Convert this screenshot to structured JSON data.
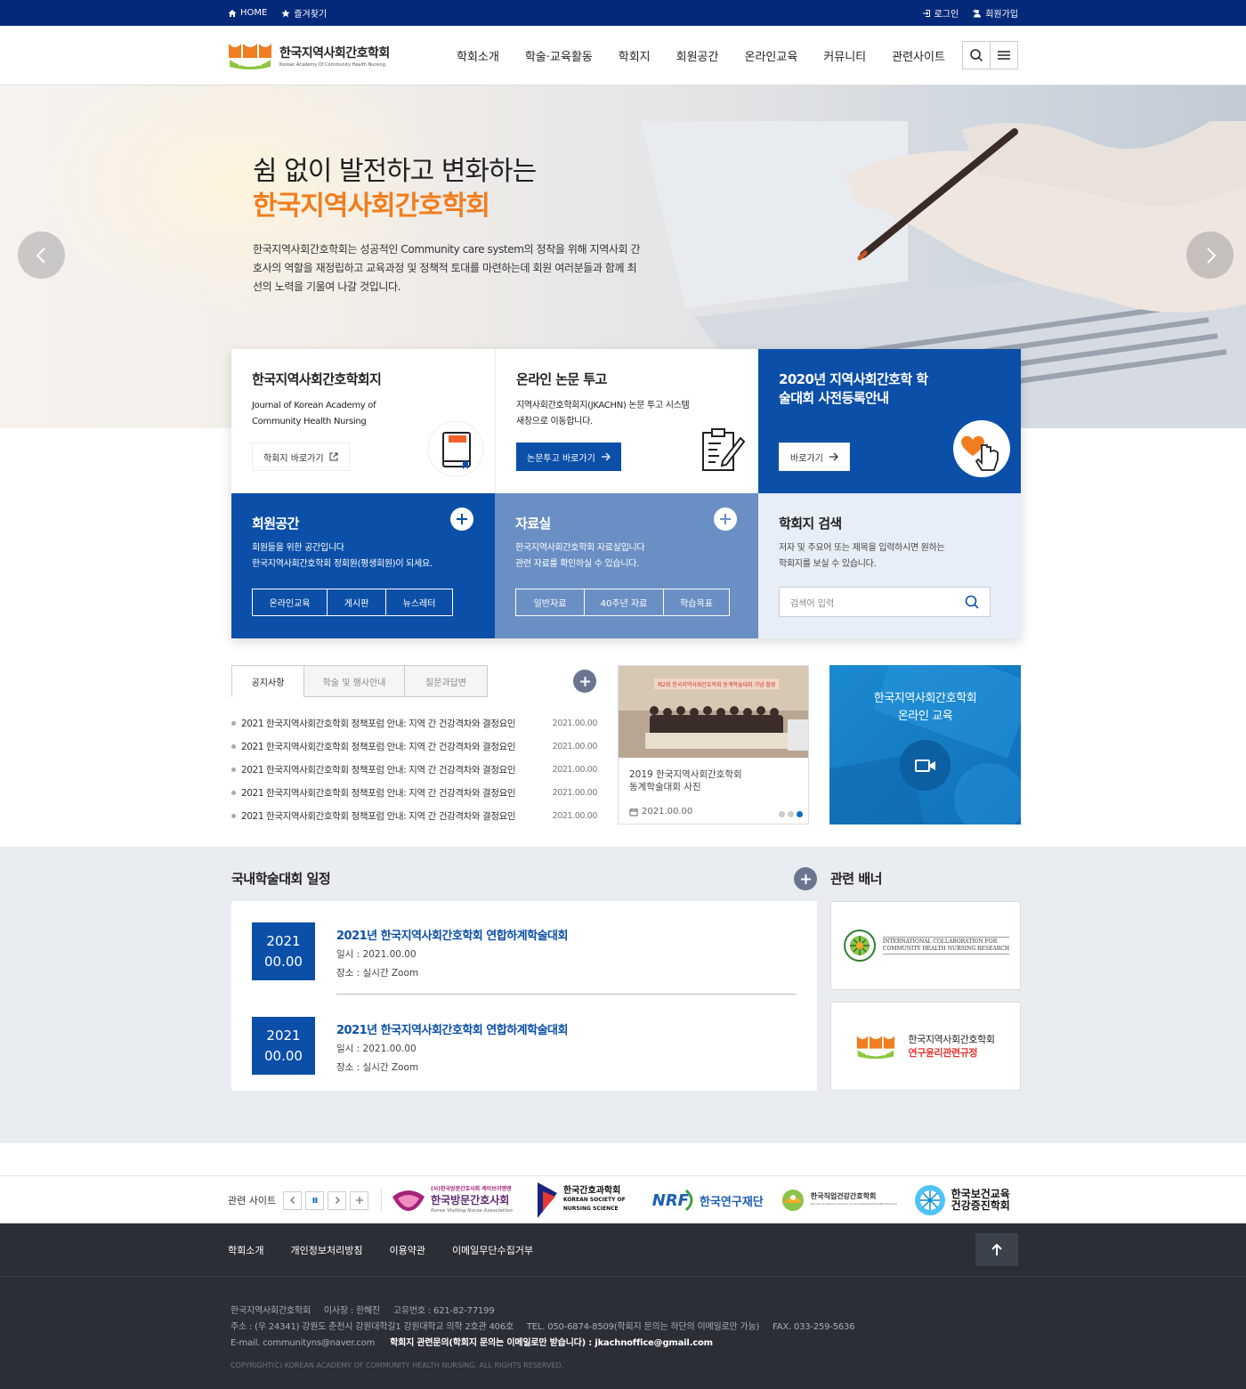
{
  "topbar": {
    "home": "HOME",
    "favorite": "즐겨찾기",
    "login": "로그인",
    "join": "회원가입"
  },
  "header": {
    "logo_ko": "한국지역사회간호학회",
    "logo_en": "Korean Academy Of Community Health Nursing",
    "logo_mark": "KACHN",
    "nav": [
      "학회소개",
      "학술·교육활동",
      "학회지",
      "회원공간",
      "온라인교육",
      "커뮤니티",
      "관련사이트"
    ]
  },
  "hero": {
    "line1": "쉼 없이 발전하고 변화하는",
    "line2": "한국지역사회간호학회",
    "desc": "한국지역사회간호학회는 성공적인 Community care system의 정착을 위해 지역사회 간호사의 역할을 재정립하고 교육과정 및 정책적 토대를 마련하는데 회원 여러분들과 함께 최선의 노력을 기울여 나갈 것입니다."
  },
  "cards": {
    "journal": {
      "title": "한국지역사회간호학회지",
      "desc": "Journal of Korean Academy of Community Health Nursing",
      "button": "학회지 바로가기"
    },
    "submit": {
      "title": "온라인 논문 투고",
      "desc": "지역사회간호학회지(JKACHN) 논문 투고 시스템 새창으로 이동합니다.",
      "button": "논문투고 바로가기"
    },
    "conference": {
      "title": "2020년 지역사회간호학 학술대회 사전등록안내",
      "button": "바로가기"
    },
    "member": {
      "title": "회원공간",
      "desc1": "회원들을 위한 공간입니다",
      "desc2": "한국지역사회간호학회 정회원(평생회원)이 되세요.",
      "links": [
        "온라인교육",
        "게시판",
        "뉴스레터"
      ]
    },
    "archive": {
      "title": "자료실",
      "desc1": "한국지역사회간호학회 자료실입니다",
      "desc2": "관련 자료를 확인하실 수 있습니다.",
      "links": [
        "일반자료",
        "40주년 자료",
        "학습목표"
      ]
    },
    "search": {
      "title": "학회지 검색",
      "desc1": "저자 및 주요어 또는 제목을 입력하시면 원하는",
      "desc2": "학회지를 보실 수 있습니다.",
      "placeholder": "검색어 입력"
    }
  },
  "notice": {
    "tabs": [
      "공지사항",
      "학술 및 행사안내",
      "질문과답변"
    ],
    "items": [
      {
        "title": "2021 한국지역사회간호학회 정책포럼 안내: 지역 간 건강격차와 결정요인",
        "date": "2021.00.00"
      },
      {
        "title": "2021 한국지역사회간호학회 정책포럼 안내: 지역 간 건강격차와 결정요인",
        "date": "2021.00.00"
      },
      {
        "title": "2021 한국지역사회간호학회 정책포럼 안내: 지역 간 건강격차와 결정요인",
        "date": "2021.00.00"
      },
      {
        "title": "2021 한국지역사회간호학회 정책포럼 안내: 지역 간 건강격차와 결정요인",
        "date": "2021.00.00"
      },
      {
        "title": "2021 한국지역사회간호학회 정책포럼 안내: 지역 간 건강격차와 결정요인",
        "date": "2021.00.00"
      }
    ]
  },
  "photo": {
    "caption_line1": "2019 한국지역사회간호학회",
    "caption_line2": "동계학술대회 사진",
    "date": "2021.00.00",
    "banner_text": "제2회 한국지역사회간호학회 동계학술대회 기념 촬영"
  },
  "edu": {
    "line1": "한국지역사회간호학회",
    "line2": "온라인 교육"
  },
  "schedule": {
    "title": "국내학술대회 일정",
    "events": [
      {
        "year": "2021",
        "md": "00.00",
        "title": "2021년 한국지역사회간호학회 연합하계학술대회",
        "when": "일시 : 2021.00.00",
        "where": "장소 : 실시간 Zoom"
      },
      {
        "year": "2021",
        "md": "00.00",
        "title": "2021년 한국지역사회간호학회 연합하계학술대회",
        "when": "일시 : 2021.00.00",
        "where": "장소 : 실시간 Zoom"
      }
    ]
  },
  "banners": {
    "title": "관련 배너",
    "icchnr_line1": "INTERNATIONAL COLLABORATION FOR",
    "icchnr_line2": "COMMUNITY HEALTH NURSING RESEARCH",
    "ethics_line1": "한국지역사회간호학회",
    "ethics_line2": "연구윤리관련규정",
    "ethics_mark": "KACHN"
  },
  "related": {
    "label": "관련 사이트",
    "sites": [
      {
        "name": "한국방문간호사회",
        "sub": "(사)한국방문간호사회 케이브이엔엔",
        "en": "Korea Visiting Nurse Association"
      },
      {
        "name": "한국간호과학회",
        "en1": "KOREAN SOCIETY OF",
        "en2": "NURSING SCIENCE"
      },
      {
        "mark": "NRF",
        "name": "한국연구재단"
      },
      {
        "name": "한국직업건강간호학회",
        "en": "Korean Academic Society of Occupational Health Nursing"
      },
      {
        "name1": "한국보건교육",
        "name2": "건강증진학회"
      }
    ]
  },
  "footer": {
    "links": [
      "학회소개",
      "개인정보처리방침",
      "이용약관",
      "이메일무단수집거부"
    ],
    "line1": "한국지역사회간호학회     이사장 : 한혜진     고유번호 : 621-82-77199",
    "line2": "주소 : (우 24341) 강원도 춘천시 강원대학길1 강원대학교 의학 2호관 406호     TEL. 050-6874-8509(학회지 문의는 하단의 이메일로만 가능)     FAX. 033-259-5636",
    "email": "E-mail. communityns@naver.com",
    "journal_email": "학회지 관련문의(학회지 문의는 이메일로만 받습니다) : jkachnoffice@gmail.com",
    "copyright": "COPYRIGHT(C) KOREAN ACADEMY OF COMMUNITY HEALTH NURSING. ALL RIGHTS RESERVED."
  },
  "colors": {
    "primary": "#0b4fa8",
    "topbar": "#05297a",
    "accent": "#f07d1f",
    "footer": "#2b2f35"
  }
}
